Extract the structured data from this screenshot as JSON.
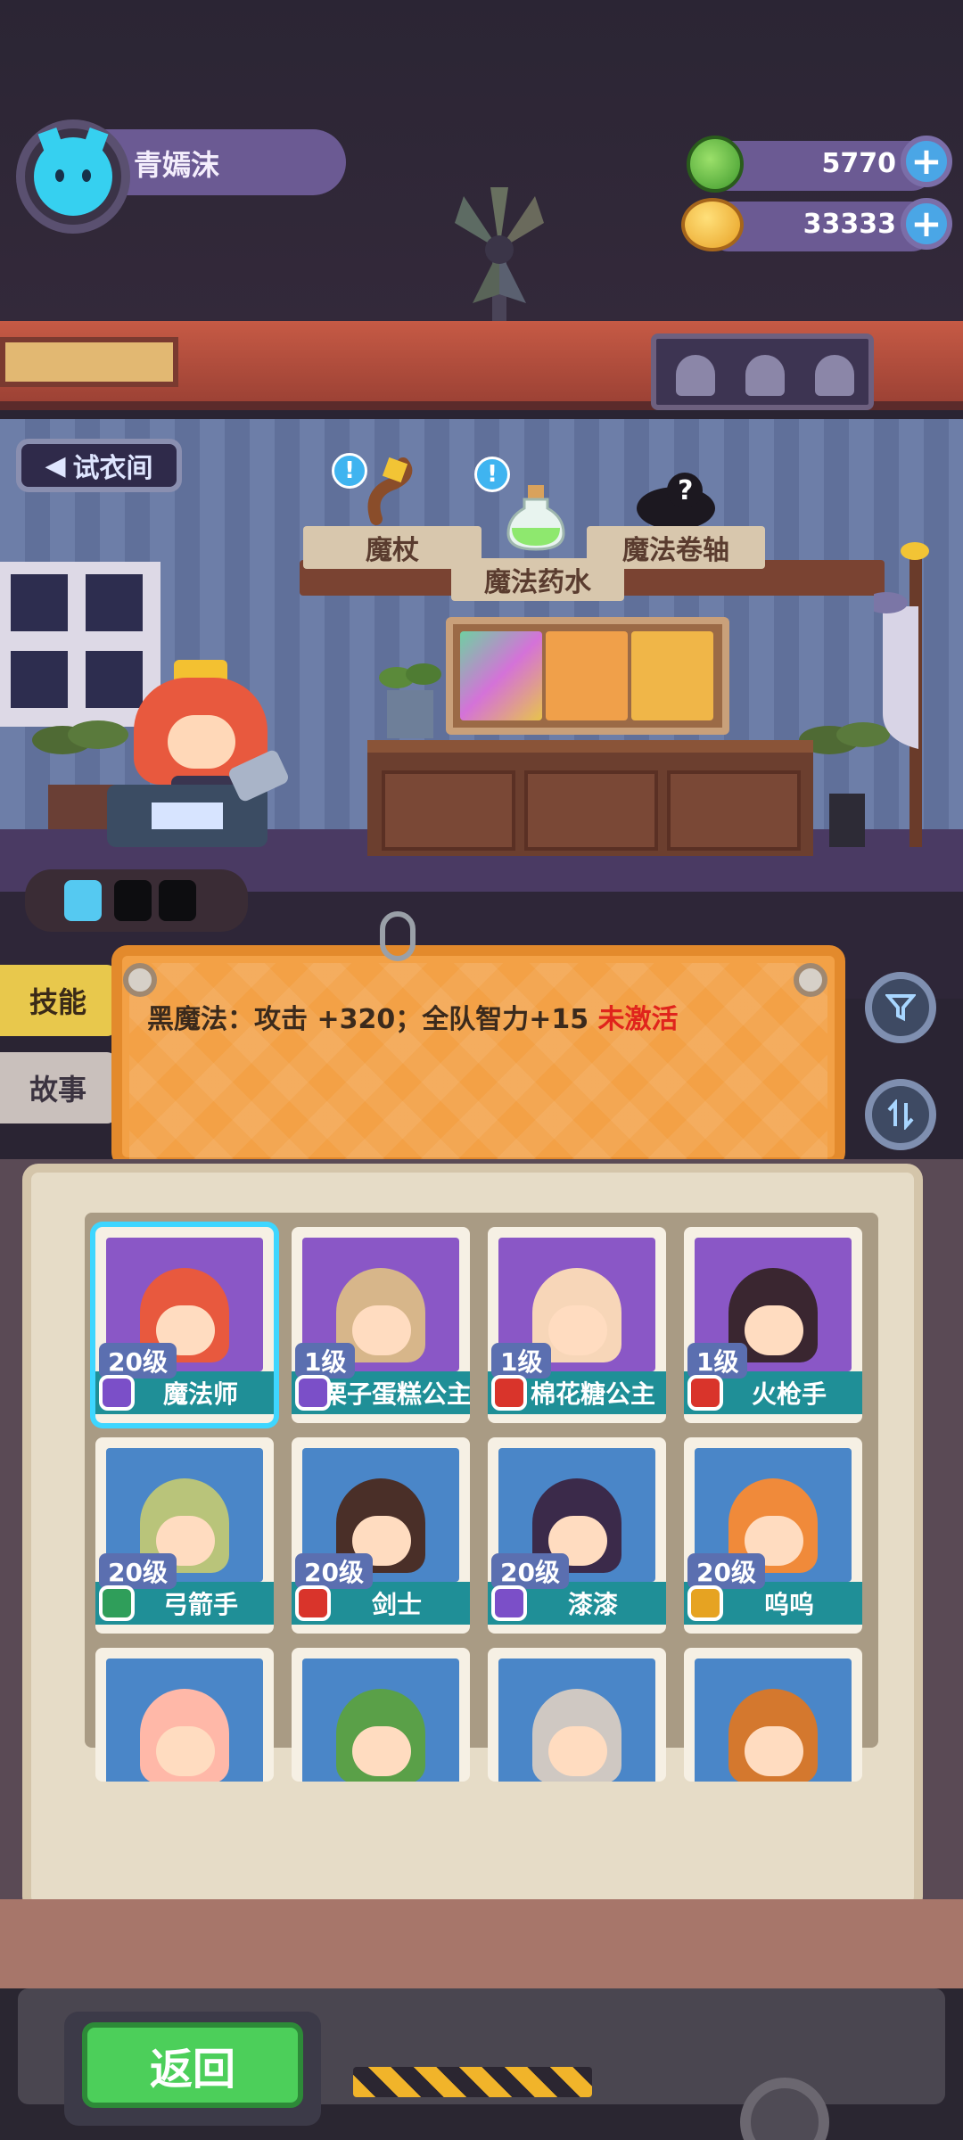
{
  "player": {
    "name": "青嫣沫",
    "avatar_icon": "cat-avatar-icon"
  },
  "currencies": [
    {
      "name": "gem",
      "icon": "gem-icon",
      "value": "5770"
    },
    {
      "name": "coin",
      "icon": "coin-icon",
      "value": "33333"
    }
  ],
  "room": {
    "exit_label": "试衣间",
    "shelf_items": [
      {
        "label": "魔杖",
        "icon": "wand-icon",
        "alert": "!"
      },
      {
        "label": "魔法药水",
        "icon": "potion-icon",
        "alert": "!"
      },
      {
        "label": "魔法卷轴",
        "icon": "scroll-icon",
        "alert": "?"
      }
    ]
  },
  "side_tabs": [
    {
      "label": "技能",
      "active": true
    },
    {
      "label": "故事",
      "active": false
    }
  ],
  "skill": {
    "text": "黑魔法：攻击 +320；全队智力+15",
    "status": "未激活",
    "status_color": "#e0241c"
  },
  "heroes": [
    {
      "level": "20级",
      "name": "魔法师",
      "class_color": "#7b4fc8",
      "bg": "#8a57c6",
      "hair": "#e8593e",
      "selected": true
    },
    {
      "level": "1级",
      "name": "栗子蛋糕公主",
      "class_color": "#7b4fc8",
      "bg": "#8a57c6",
      "hair": "#d7b68a",
      "selected": false
    },
    {
      "level": "1级",
      "name": "棉花糖公主",
      "class_color": "#d9342b",
      "bg": "#8a57c6",
      "hair": "#f7d6b8",
      "selected": false
    },
    {
      "level": "1级",
      "name": "火枪手",
      "class_color": "#d9342b",
      "bg": "#8a57c6",
      "hair": "#3a2630",
      "selected": false
    },
    {
      "level": "20级",
      "name": "弓箭手",
      "class_color": "#2f9e5a",
      "bg": "#4a86c8",
      "hair": "#b9c47a",
      "selected": false
    },
    {
      "level": "20级",
      "name": "剑士",
      "class_color": "#d9342b",
      "bg": "#4a86c8",
      "hair": "#4a2f28",
      "selected": false
    },
    {
      "level": "20级",
      "name": "漆漆",
      "class_color": "#7b4fc8",
      "bg": "#4a86c8",
      "hair": "#3b2a4a",
      "selected": false
    },
    {
      "level": "20级",
      "name": "呜呜",
      "class_color": "#e6a322",
      "bg": "#4a86c8",
      "hair": "#f08a3a",
      "selected": false
    },
    {
      "level": "",
      "name": "",
      "class_color": "",
      "bg": "#4a86c8",
      "hair": "#ffb8a8",
      "selected": false
    },
    {
      "level": "",
      "name": "",
      "class_color": "",
      "bg": "#4a86c8",
      "hair": "#5aa048",
      "selected": false
    },
    {
      "level": "",
      "name": "",
      "class_color": "",
      "bg": "#4a86c8",
      "hair": "#cfc8c2",
      "selected": false
    },
    {
      "level": "",
      "name": "",
      "class_color": "",
      "bg": "#4a86c8",
      "hair": "#d4782e",
      "selected": false
    }
  ],
  "footer": {
    "back_label": "返回"
  }
}
